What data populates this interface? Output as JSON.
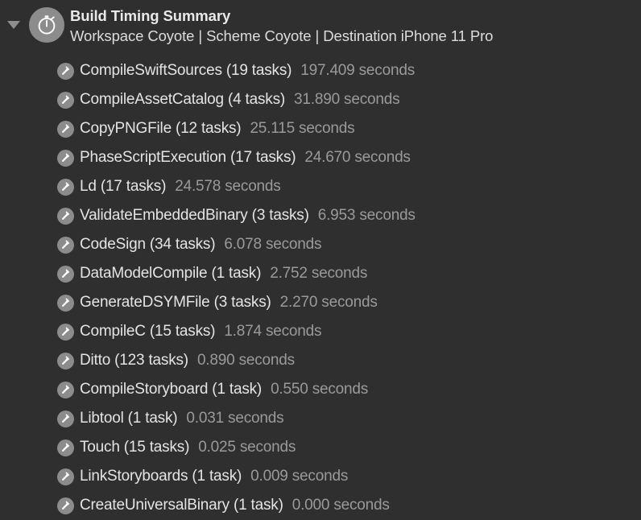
{
  "theme": {
    "background": "#2f2f2f",
    "title_color": "#e9e9e9",
    "label_color": "#e4e4e4",
    "duration_color": "#9a9a9a",
    "icon_circle_color": "#8c8c8c",
    "disclosure_color": "#8e8e8e"
  },
  "header": {
    "disclosure_state": "expanded",
    "disclosure_icon": "triangle-down-icon",
    "group_icon": "stopwatch-icon",
    "title": "Build Timing Summary",
    "subtitle": "Workspace Coyote | Scheme Coyote | Destination iPhone 11 Pro"
  },
  "rows": [
    {
      "icon": "hammer-icon",
      "label": "CompileSwiftSources (19 tasks)",
      "duration": "197.409 seconds",
      "task_name": "CompileSwiftSources",
      "task_count": 19,
      "seconds": 197.409
    },
    {
      "icon": "hammer-icon",
      "label": "CompileAssetCatalog (4 tasks)",
      "duration": "31.890 seconds",
      "task_name": "CompileAssetCatalog",
      "task_count": 4,
      "seconds": 31.89
    },
    {
      "icon": "hammer-icon",
      "label": "CopyPNGFile (12 tasks)",
      "duration": "25.115 seconds",
      "task_name": "CopyPNGFile",
      "task_count": 12,
      "seconds": 25.115
    },
    {
      "icon": "hammer-icon",
      "label": "PhaseScriptExecution (17 tasks)",
      "duration": "24.670 seconds",
      "task_name": "PhaseScriptExecution",
      "task_count": 17,
      "seconds": 24.67
    },
    {
      "icon": "hammer-icon",
      "label": "Ld (17 tasks)",
      "duration": "24.578 seconds",
      "task_name": "Ld",
      "task_count": 17,
      "seconds": 24.578
    },
    {
      "icon": "hammer-icon",
      "label": "ValidateEmbeddedBinary (3 tasks)",
      "duration": "6.953 seconds",
      "task_name": "ValidateEmbeddedBinary",
      "task_count": 3,
      "seconds": 6.953
    },
    {
      "icon": "hammer-icon",
      "label": "CodeSign (34 tasks)",
      "duration": "6.078 seconds",
      "task_name": "CodeSign",
      "task_count": 34,
      "seconds": 6.078
    },
    {
      "icon": "hammer-icon",
      "label": "DataModelCompile (1 task)",
      "duration": "2.752 seconds",
      "task_name": "DataModelCompile",
      "task_count": 1,
      "seconds": 2.752
    },
    {
      "icon": "hammer-icon",
      "label": "GenerateDSYMFile (3 tasks)",
      "duration": "2.270 seconds",
      "task_name": "GenerateDSYMFile",
      "task_count": 3,
      "seconds": 2.27
    },
    {
      "icon": "hammer-icon",
      "label": "CompileC (15 tasks)",
      "duration": "1.874 seconds",
      "task_name": "CompileC",
      "task_count": 15,
      "seconds": 1.874
    },
    {
      "icon": "hammer-icon",
      "label": "Ditto (123 tasks)",
      "duration": "0.890 seconds",
      "task_name": "Ditto",
      "task_count": 123,
      "seconds": 0.89
    },
    {
      "icon": "hammer-icon",
      "label": "CompileStoryboard (1 task)",
      "duration": "0.550 seconds",
      "task_name": "CompileStoryboard",
      "task_count": 1,
      "seconds": 0.55
    },
    {
      "icon": "hammer-icon",
      "label": "Libtool (1 task)",
      "duration": "0.031 seconds",
      "task_name": "Libtool",
      "task_count": 1,
      "seconds": 0.031
    },
    {
      "icon": "hammer-icon",
      "label": "Touch (15 tasks)",
      "duration": "0.025 seconds",
      "task_name": "Touch",
      "task_count": 15,
      "seconds": 0.025
    },
    {
      "icon": "hammer-icon",
      "label": "LinkStoryboards (1 task)",
      "duration": "0.009 seconds",
      "task_name": "LinkStoryboards",
      "task_count": 1,
      "seconds": 0.009
    },
    {
      "icon": "hammer-icon",
      "label": "CreateUniversalBinary (1 task)",
      "duration": "0.000 seconds",
      "task_name": "CreateUniversalBinary",
      "task_count": 1,
      "seconds": 0.0
    }
  ]
}
